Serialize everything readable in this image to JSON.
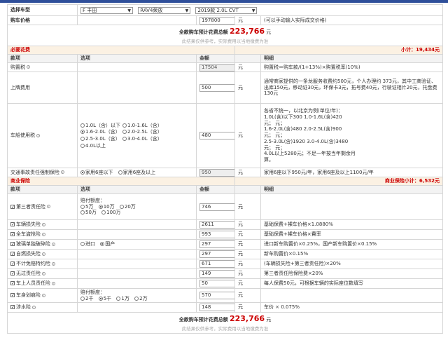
{
  "selector": {
    "label": "选择车型",
    "brand": "F 丰田",
    "series": "RAV4荣放",
    "model": "2019款 2.0L CVT"
  },
  "price": {
    "label": "购车价格",
    "value": "197800",
    "unit": "元",
    "hint": "(可以手动输入实际成交价格)"
  },
  "total": {
    "label": "全款购车预计花费总额",
    "value": "223,766",
    "unit": "元",
    "note": "此结果仅供参考，实际费用以当地缴费为准"
  },
  "required": {
    "title": "必要花费",
    "subtotal": "小计：19,434元",
    "headers": [
      "款项",
      "选项",
      "金额",
      "",
      "明细"
    ],
    "purchase_tax": {
      "name": "购置税",
      "amount": "17504",
      "unit": "元",
      "detail": "购置税＝购车款/(1+13%)×购置税率(10%)"
    },
    "plate_fee": {
      "name": "上牌费用",
      "amount": "500",
      "unit": "元",
      "detail": "通常商家提供的一条龙服务收费约500元，个人办理约 373元，其中工商验证、出库150元，移动证30元，环保卡3元，拓号费40元，行驶证相片20元，托盘费130元"
    },
    "vehicle_tax": {
      "name": "车船使用税",
      "options": [
        "1.0L（含）以下",
        "1.0-1.6L（含）",
        "1.6-2.0L（含）",
        "2.0-2.5L（含）",
        "2.5-3.0L（含）",
        "3.0-4.0L（含）",
        "4.0L以上"
      ],
      "selected": "1.6-2.0L（含）",
      "amount": "480",
      "unit": "元",
      "detail": [
        "各省不统一，以北京为例(单位/年)：",
        "1.0L(含)以下300      1.0-1.6L(含)420",
        "元；                          元；",
        "1.6-2.0L(含)480      2.0-2.5L(含)900",
        "元；                          元；",
        "2.5-3.0L(含)1920     3.0-4.0L(含)3480",
        "元；                          元；",
        "4.0L以上5280元；不足一年按当年剩余月",
        "算。"
      ]
    },
    "compulsory": {
      "name": "交通事故责任强制保险",
      "options": [
        "家用6座以下",
        "家用6座及以上"
      ],
      "selected": "家用6座以下",
      "amount": "950",
      "unit": "元",
      "detail": "家用6座以下950元/年，家用6座及以上1100元/年"
    }
  },
  "commercial": {
    "title": "商业保险",
    "subtotal": "商业保险小计：6,532元",
    "headers": [
      "款项",
      "选项",
      "金额",
      "",
      "明细"
    ],
    "third_party": {
      "name": "第三者责任险",
      "options_label": "赔付额度：",
      "options": [
        "5万",
        "10万",
        "20万",
        "50万",
        "100万"
      ],
      "selected": "10万",
      "amount": "746",
      "unit": "元",
      "detail": ""
    },
    "rows": [
      {
        "name": "车辆损失险",
        "amount": "2611",
        "unit": "元",
        "detail": "基础保费+裸车价格×1.0880%"
      },
      {
        "name": "全车盗抢险",
        "amount": "993",
        "unit": "元",
        "detail": "基础保费+裸车价格×費率"
      },
      {
        "name": "玻璃单独破碎险",
        "amount": "297",
        "unit": "元",
        "detail": "进口新车购置价×0.25%，国产新车购置价×0.15%",
        "options": [
          "进口",
          "国产"
        ],
        "selected": "国产"
      },
      {
        "name": "自燃损失险",
        "amount": "297",
        "unit": "元",
        "detail": "新车购置价×0.15%"
      },
      {
        "name": "不计免赔特约险",
        "amount": "671",
        "unit": "元",
        "detail": "(车辆损失险+第三者责任险)×20%"
      },
      {
        "name": "无过责任险",
        "amount": "149",
        "unit": "元",
        "detail": "第三者责任险保险费×20%"
      },
      {
        "name": "车上人员责任险",
        "amount": "50",
        "unit": "元",
        "detail": "每人保费50元，可根据车辆的实际座位数填写"
      }
    ],
    "scratch": {
      "name": "车身划痕险",
      "options_label": "赔付额度：",
      "options": [
        "2千",
        "5千",
        "1万",
        "2万"
      ],
      "selected": "5千",
      "amount": "570",
      "unit": "元",
      "detail": ""
    },
    "wading": {
      "name": "涉水险",
      "amount": "148",
      "unit": "元",
      "detail": "车价 × 0.075%"
    }
  },
  "footer_total": {
    "label": "全款购车预计花费总额",
    "value": "223,766",
    "unit": "元",
    "note": "此结果仅供参考，实际费用以当地缴费为准"
  }
}
